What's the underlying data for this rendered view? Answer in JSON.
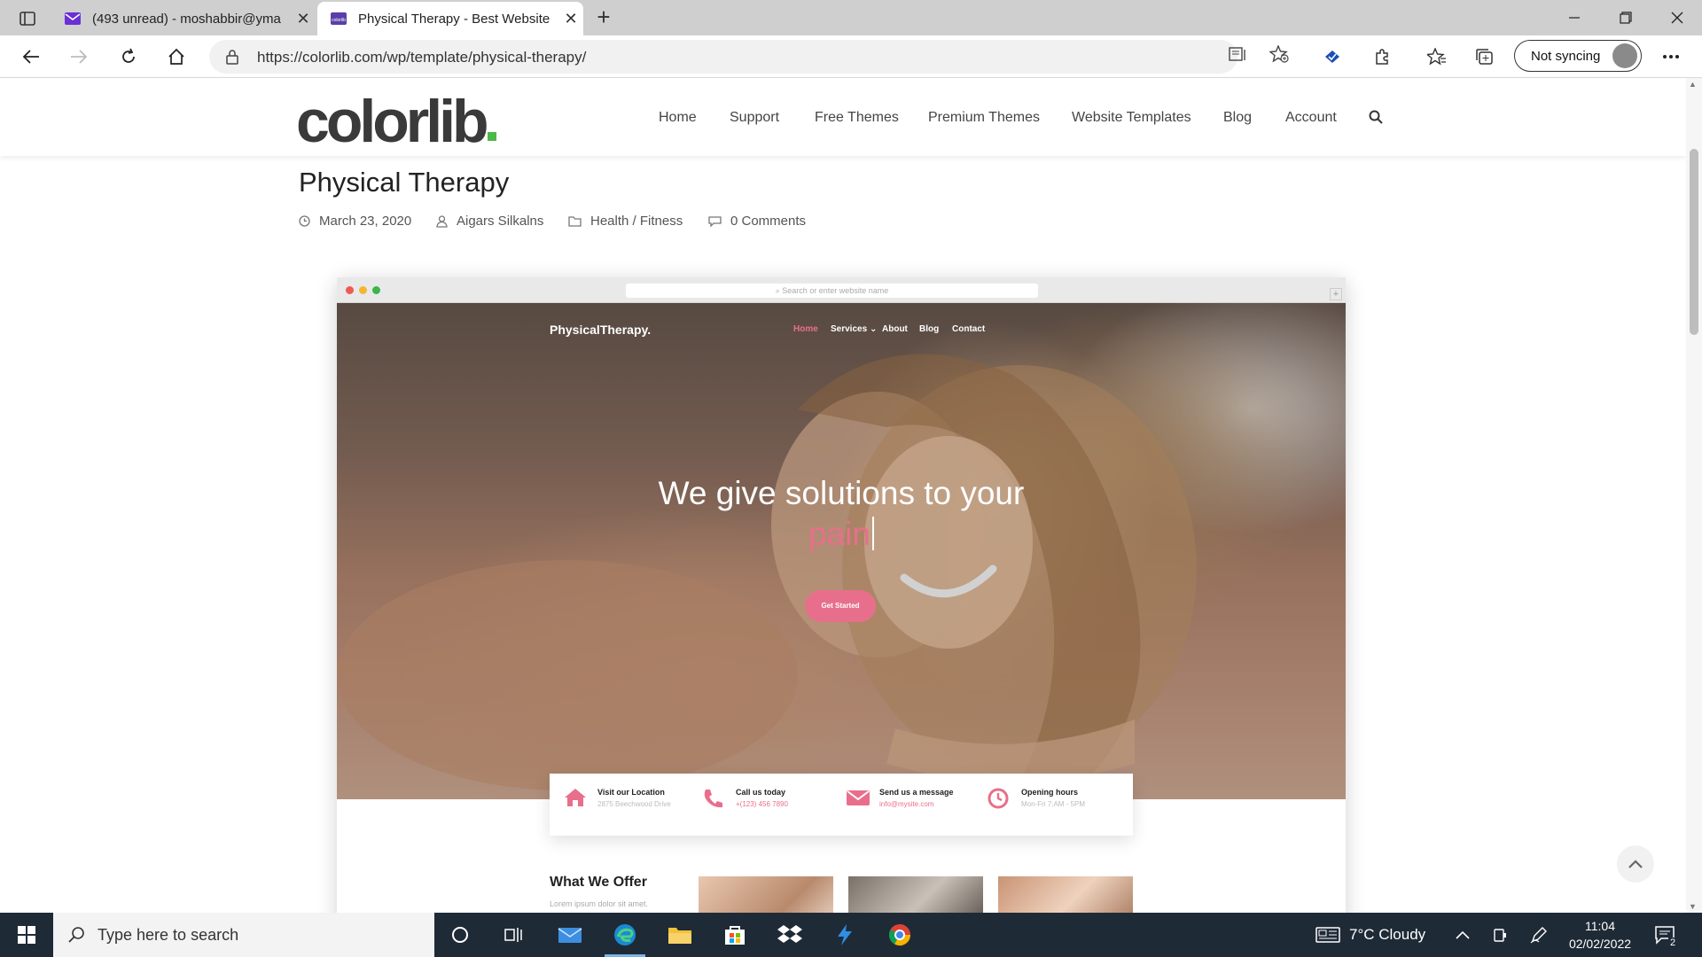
{
  "browser": {
    "tabs": [
      {
        "title": "(493 unread) - moshabbir@yma",
        "active": false,
        "favicon": "mail-icon"
      },
      {
        "title": "Physical Therapy - Best Website",
        "active": true,
        "favicon": "colorlib-icon"
      }
    ],
    "url": "https://colorlib.com/wp/template/physical-therapy/",
    "sync_label": "Not syncing"
  },
  "site": {
    "logo": "colorlib",
    "nav": [
      "Home",
      "Support",
      "Free Themes",
      "Premium Themes",
      "Website Templates",
      "Blog",
      "Account"
    ]
  },
  "post": {
    "title": "Physical Therapy",
    "date": "March 23, 2020",
    "author": "Aigars Silkalns",
    "category": "Health / Fitness",
    "comments": "0 Comments"
  },
  "preview": {
    "address_placeholder": "Search or enter website name",
    "brand": "PhysicalTherapy.",
    "nav": [
      "Home",
      "Services",
      "About",
      "Blog",
      "Contact"
    ],
    "hero_title_line1": "We give solutions to your",
    "hero_title_accent": "pain",
    "cta": "Get Started",
    "accent_color": "#e86f8b",
    "info": [
      {
        "label": "Visit our Location",
        "value": "2875 Beechwood Drive",
        "icon": "home-icon"
      },
      {
        "label": "Call us today",
        "value": "+(123) 456 7890",
        "icon": "phone-icon"
      },
      {
        "label": "Send us a message",
        "value": "info@mysite.com",
        "icon": "envelope-icon"
      },
      {
        "label": "Opening hours",
        "value": "Mon-Fri 7:AM - 5PM",
        "icon": "clock-icon"
      }
    ],
    "offer_title": "What We Offer",
    "offer_sub": "Lorem ipsum dolor sit amet."
  },
  "taskbar": {
    "search_placeholder": "Type here to search",
    "weather": "7°C  Cloudy",
    "time": "11:04",
    "date": "02/02/2022",
    "notifications": "2"
  }
}
